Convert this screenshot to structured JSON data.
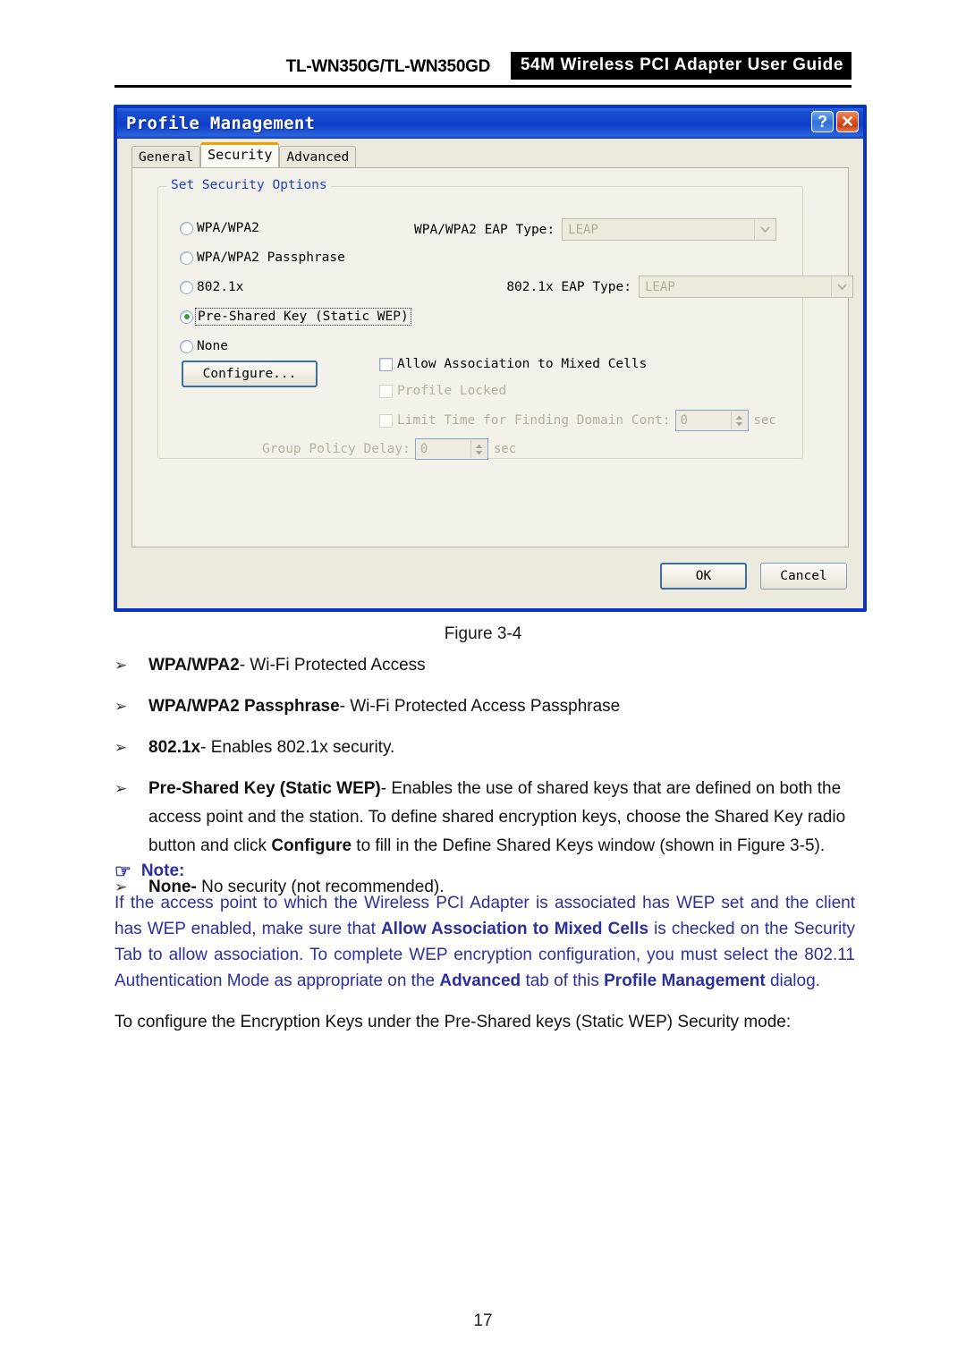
{
  "header": {
    "model": "TL-WN350G/TL-WN350GD",
    "product_box": "54M Wireless PCI Adapter User Guide"
  },
  "dialog": {
    "title": "Profile Management",
    "titlebar_buttons": [
      {
        "name": "help-button",
        "glyph": "?"
      },
      {
        "name": "close-button",
        "glyph": "✕"
      }
    ],
    "tabs": [
      {
        "label": "General",
        "active": false
      },
      {
        "label": "Security",
        "active": true
      },
      {
        "label": "Advanced",
        "active": false
      }
    ],
    "group_title": "Set Security Options",
    "radios": [
      {
        "label": "WPA/WPA2",
        "checked": false,
        "focused": false
      },
      {
        "label": "WPA/WPA2 Passphrase",
        "checked": false,
        "focused": false
      },
      {
        "label": "802.1x",
        "checked": false,
        "focused": false
      },
      {
        "label": "Pre-Shared Key (Static WEP)",
        "checked": true,
        "focused": true
      },
      {
        "label": "None",
        "checked": false,
        "focused": false
      }
    ],
    "eap_rows": [
      {
        "label": "WPA/WPA2 EAP Type:",
        "value": "LEAP",
        "disabled": true
      },
      {
        "label": "802.1x EAP Type:",
        "value": "LEAP",
        "disabled": true
      }
    ],
    "configure_button": "Configure...",
    "checkboxes": [
      {
        "label": "Allow Association to Mixed Cells",
        "checked": false,
        "disabled": false
      },
      {
        "label": "Profile Locked",
        "checked": false,
        "disabled": true
      },
      {
        "label": "Limit Time for Finding Domain Cont:",
        "checked": false,
        "disabled": true
      }
    ],
    "limit_time_spinner": {
      "value": "0",
      "unit": "sec"
    },
    "group_policy_delay": {
      "label": "Group Policy Delay:",
      "value": "0",
      "unit": "sec"
    },
    "ok_button": "OK",
    "cancel_button": "Cancel"
  },
  "document": {
    "figure_caption": "Figure 3-4",
    "bullet_marker": "➢",
    "bullets": [
      {
        "bold": "WPA/WPA2",
        "rest": "- Wi-Fi Protected Access"
      },
      {
        "bold": "WPA/WPA2 Passphrase",
        "rest": "- Wi-Fi Protected Access Passphrase"
      },
      {
        "bold": "802.1x",
        "rest": "- Enables 802.1x security."
      },
      {
        "bold": "Pre-Shared Key (Static WEP)",
        "rest": "- Enables the use of shared keys that are defined on both the access point and the station. To define shared encryption keys, choose the Shared Key radio button and click ",
        "bold2": "Configure",
        "rest2": " to fill in the Define Shared Keys window (shown in Figure 3-5)."
      },
      {
        "bold": "None-",
        "rest": " No security (not recommended)."
      }
    ],
    "note": {
      "icon": "☞",
      "heading": "Note:",
      "part1": "If the access point to which the Wireless PCI Adapter is associated has WEP set and the client has WEP enabled, make sure that ",
      "bold1": "Allow Association to Mixed Cells",
      "part2": " is checked on the Security Tab to allow association. To complete WEP encryption configuration, you must select the 802.11 Authentication Mode as appropriate on the ",
      "bold2": "Advanced",
      "part3": " tab of this ",
      "bold3": "Profile Management",
      "part4": " dialog."
    },
    "closing_text": "To configure the Encryption Keys under the Pre-Shared keys (Static WEP) Security mode:",
    "page_number": "17"
  }
}
